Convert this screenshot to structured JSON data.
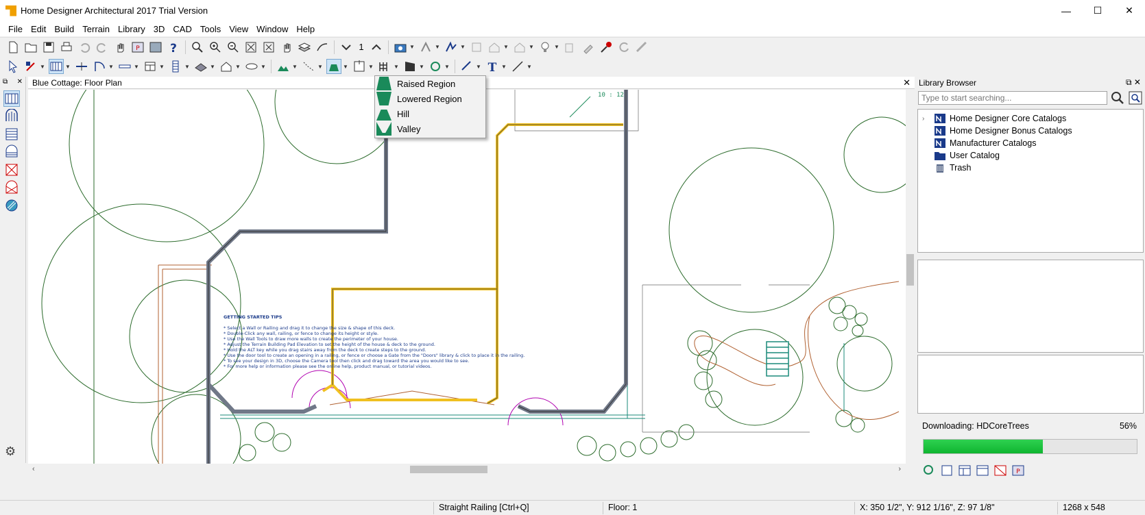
{
  "window": {
    "title": "Home Designer Architectural 2017 Trial Version",
    "minimize": "—",
    "maximize": "☐",
    "close": "✕"
  },
  "menu": [
    "File",
    "Edit",
    "Build",
    "Terrain",
    "Library",
    "3D",
    "CAD",
    "Tools",
    "View",
    "Window",
    "Help"
  ],
  "toolbar": {
    "floor_number": "1"
  },
  "document": {
    "title": "Blue Cottage: Floor Plan",
    "close": "✕",
    "roof_label": "10 : 12",
    "tips_title": "GETTING STARTED TIPS",
    "tips": [
      "* Select a Wall or Railing and drag it to change the size & shape of this deck.",
      "* Double-Click any wall, railing, or fence to change its height or style.",
      "* Use the Wall Tools to draw more walls to create the perimeter of your house.",
      "* Adjust the Terrain Building Pad Elevation to set the height of the house & deck to the ground.",
      "* Hold the ALT key while you drag stairs away from the deck to create steps to the ground.",
      "* Use the door tool to create an opening in a railing, or fence or choose a Gate from the \"Doors\" library & click to place it in the railing.",
      "* To see your design in 3D, choose the Camera tool then click and drag toward the area you would like to see.",
      "* For more help or information please see the online help, product manual, or tutorial videos."
    ]
  },
  "terrain_menu": {
    "items": [
      "Raised Region",
      "Lowered Region",
      "Hill",
      "Valley"
    ],
    "accent": "#1a8a5a"
  },
  "library": {
    "title": "Library Browser",
    "search_placeholder": "Type to start searching...",
    "items": [
      {
        "label": "Home Designer Core Catalogs",
        "icon": "catalog-icon",
        "expandable": true
      },
      {
        "label": "Home Designer Bonus Catalogs",
        "icon": "catalog-icon",
        "expandable": false
      },
      {
        "label": "Manufacturer Catalogs",
        "icon": "catalog-icon",
        "expandable": false
      },
      {
        "label": "User Catalog",
        "icon": "folder-icon",
        "expandable": false
      },
      {
        "label": "Trash",
        "icon": "trash-icon",
        "expandable": false
      }
    ],
    "download_label": "Downloading:  HDCoreTrees",
    "download_percent_text": "56%",
    "download_progress": 0.56
  },
  "status": {
    "tool": "Straight Railing [Ctrl+Q]",
    "floor": "Floor: 1",
    "coords": "X: 350 1/2\", Y: 912 1/16\", Z: 97 1/8\"",
    "size": "1268 x 548"
  },
  "colors": {
    "wall": "#707888",
    "yellow_wall": "#f0c020",
    "tree": "#2a6a2a",
    "terrain_line": "#b06030",
    "tips_text": "#1a3a8a"
  }
}
